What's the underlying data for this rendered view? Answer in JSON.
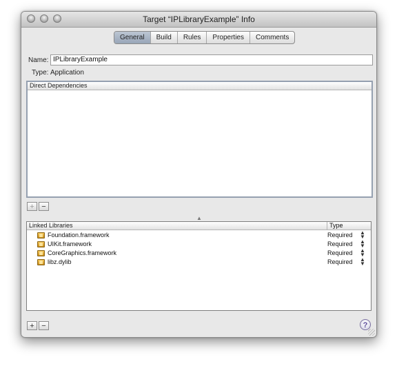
{
  "window": {
    "title": "Target “IPLibraryExample” Info"
  },
  "tabs": [
    {
      "label": "General",
      "active": true
    },
    {
      "label": "Build"
    },
    {
      "label": "Rules"
    },
    {
      "label": "Properties"
    },
    {
      "label": "Comments"
    }
  ],
  "general": {
    "name_label": "Name:",
    "name_value": "IPLibraryExample",
    "type_label": "Type:",
    "type_value": "Application"
  },
  "dependencies": {
    "header": "Direct Dependencies",
    "add_label": "+",
    "remove_label": "−"
  },
  "libraries": {
    "header": "Linked Libraries",
    "type_header": "Type",
    "add_label": "+",
    "remove_label": "−",
    "items": [
      {
        "name": "Foundation.framework",
        "type": "Required"
      },
      {
        "name": "UIKit.framework",
        "type": "Required"
      },
      {
        "name": "CoreGraphics.framework",
        "type": "Required"
      },
      {
        "name": "libz.dylib",
        "type": "Required"
      }
    ]
  },
  "help": {
    "label": "?"
  },
  "icons": [
    "close-button",
    "minimize-button",
    "zoom-button",
    "framework-icon",
    "stepper-icon",
    "help-icon",
    "resize-grip-icon"
  ]
}
